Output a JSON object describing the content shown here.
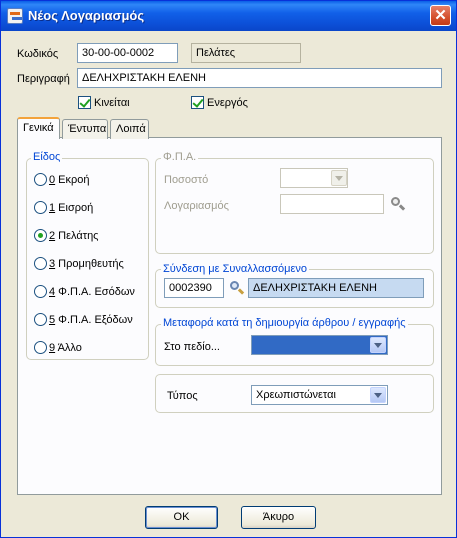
{
  "window": {
    "title": "Νέος Λογαριασμός",
    "close_glyph": "✕"
  },
  "form": {
    "code_label": "Κωδικός",
    "code_value": "30-00-00-0002",
    "category_value": "Πελάτες",
    "description_label": "Περιγραφή",
    "description_value": "ΔΕΛΗΧΡΙΣΤΑΚΗ ΕΛΕΝΗ",
    "moving_label": "Κινείται",
    "active_label": "Ενεργός"
  },
  "tabs": [
    {
      "label": "Γενικά",
      "active": true
    },
    {
      "label": "Έντυπα",
      "active": false
    },
    {
      "label": "Λοιπά",
      "active": false
    }
  ],
  "type_group": {
    "title": "Είδος",
    "options": [
      {
        "key": "0",
        "rest": " Εκροή",
        "selected": false
      },
      {
        "key": "1",
        "rest": " Εισροή",
        "selected": false
      },
      {
        "key": "2",
        "rest": " Πελάτης",
        "selected": true
      },
      {
        "key": "3",
        "rest": " Προμηθευτής",
        "selected": false
      },
      {
        "key": "4",
        "rest": " Φ.Π.Α. Εσόδων",
        "selected": false
      },
      {
        "key": "5",
        "rest": " Φ.Π.Α. Εξόδων",
        "selected": false
      },
      {
        "key": "9",
        "rest": " Άλλο",
        "selected": false
      }
    ]
  },
  "vat_group": {
    "title": "Φ.Π.Α.",
    "percent_label": "Ποσοστό",
    "percent_value": "",
    "account_label": "Λογαριασμός",
    "account_value": ""
  },
  "link_group": {
    "title": "Σύνδεση με Συναλλασσόμενο",
    "code_value": "0002390",
    "name_value": "ΔΕΛΗΧΡΙΣΤΑΚΗ ΕΛΕΝΗ"
  },
  "transfer_group": {
    "title": "Μεταφορά κατά τη δημιουργία άρθρου / εγγραφής",
    "field_label": "Στο πεδίο...",
    "field_value": ""
  },
  "kind_group": {
    "label": "Τύπος",
    "value": "Χρεωπιστώνεται"
  },
  "buttons": {
    "ok": "OK",
    "cancel": "Άκυρο"
  },
  "colors": {
    "titlebar": "#0a5fe6",
    "window_bg": "#ece9d8",
    "selection": "#316ac5",
    "link_field": "#c6daf1"
  }
}
